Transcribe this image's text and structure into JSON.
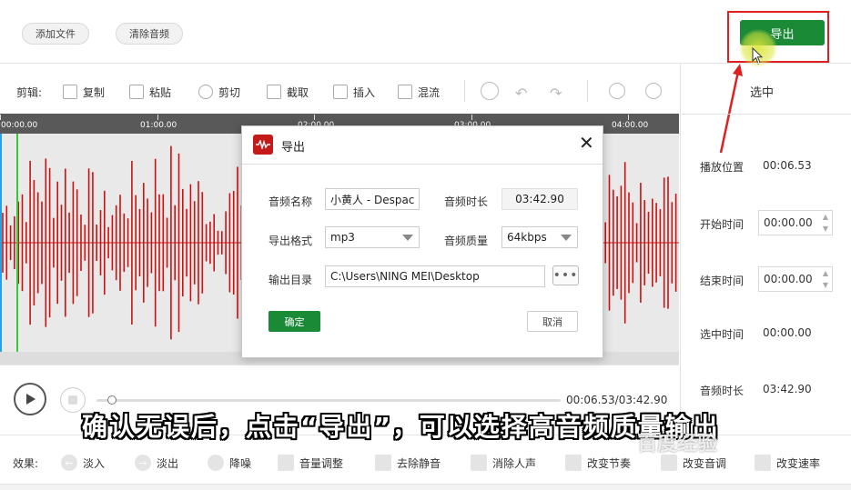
{
  "top": {
    "add_file": "添加文件",
    "clear_audio": "清除音频",
    "export": "导出"
  },
  "toolbar": {
    "edit_label": "剪辑:",
    "copy": "复制",
    "paste": "粘贴",
    "cut": "剪切",
    "crop": "截取",
    "insert": "插入",
    "mix": "混流"
  },
  "sidebar": {
    "title": "选中",
    "play_pos_label": "播放位置",
    "play_pos": "00:06.53",
    "start_label": "开始时间",
    "start": "00:00.00",
    "end_label": "结束时间",
    "end": "00:00.00",
    "sel_label": "选中时间",
    "sel": "00:00.00",
    "dur_label": "音频时长",
    "dur": "03:42.90"
  },
  "ruler": [
    "00:00.00",
    "01:00.00",
    "02:00.00",
    "03:00.00",
    "04:00.00"
  ],
  "player": {
    "time": "00:06.53/03:42.90",
    "progress": 0.03
  },
  "effects": {
    "label": "效果:",
    "items": [
      "淡入",
      "淡出",
      "降噪",
      "音量调整",
      "去除静音",
      "消除人声",
      "改变节奏",
      "改变音调",
      "改变速率"
    ]
  },
  "dialog": {
    "title": "导出",
    "name_label": "音频名称",
    "name_value": "小黄人 - Despac",
    "duration_label": "音频时长",
    "duration_value": "03:42.90",
    "format_label": "导出格式",
    "format_value": "mp3",
    "quality_label": "音频质量",
    "quality_value": "64kbps",
    "dir_label": "输出目录",
    "dir_value": "C:\\Users\\NING MEI\\Desktop",
    "more": "•••",
    "ok": "确定",
    "cancel": "取消"
  },
  "caption": "确认无误后，点击“导出”，可以选择高音频质量输出",
  "watermark": "百度经验",
  "colors": {
    "accent_green": "#1a8a37",
    "waveform_red": "#cc1111",
    "highlight_red": "#e02020"
  }
}
